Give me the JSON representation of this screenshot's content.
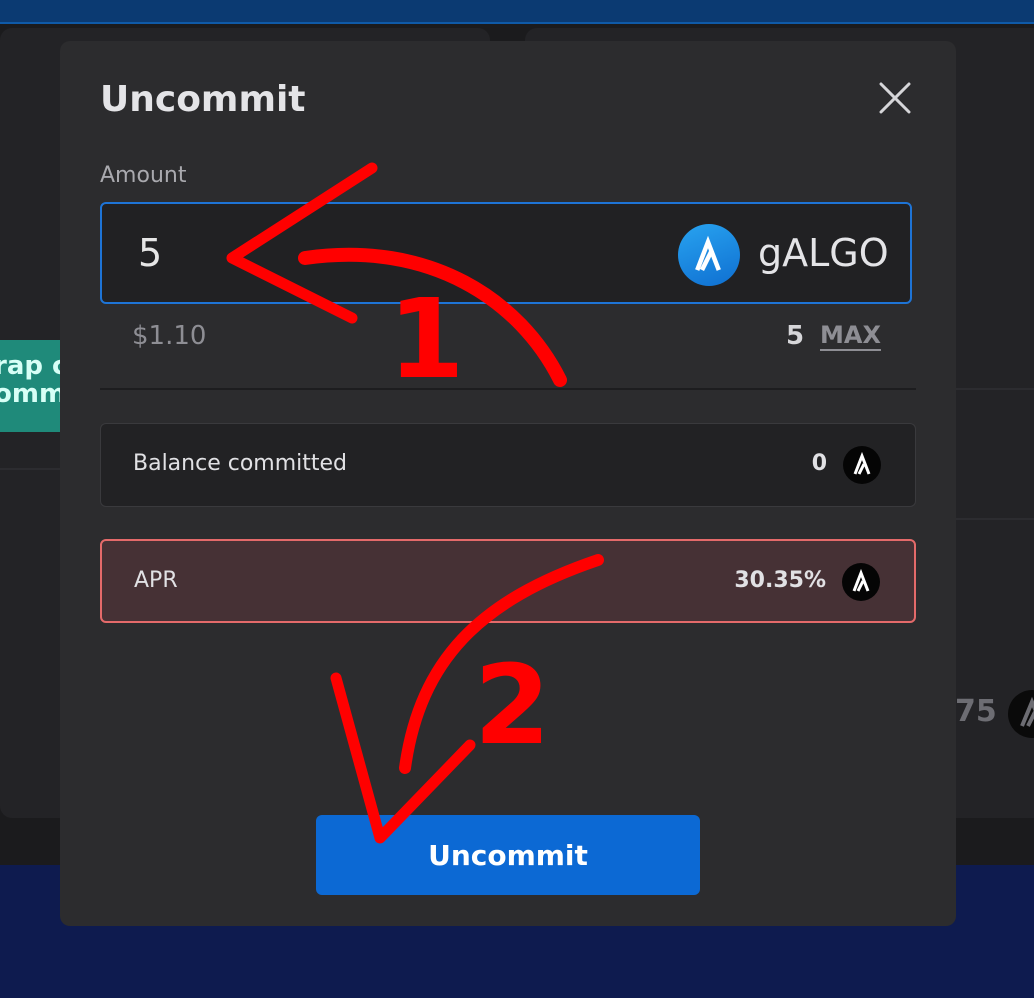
{
  "background": {
    "green_tag_lines": [
      "rap c",
      "omm"
    ],
    "partial_value": "75"
  },
  "modal": {
    "title": "Uncommit",
    "amount_label": "Amount",
    "amount_value": "5",
    "token_name": "gALGO",
    "usd_value": "$1.10",
    "available_balance": "5",
    "max_label": "MAX",
    "balance_committed_label": "Balance committed",
    "balance_committed_value": "0",
    "apr_label": "APR",
    "apr_value": "30.35%",
    "submit_label": "Uncommit"
  },
  "annotations": {
    "step1": "1",
    "step2": "2",
    "color": "#ff0000"
  },
  "colors": {
    "accent": "#0c69d4",
    "apr_border": "#e46a6a",
    "modal_bg": "#2c2c2e"
  }
}
